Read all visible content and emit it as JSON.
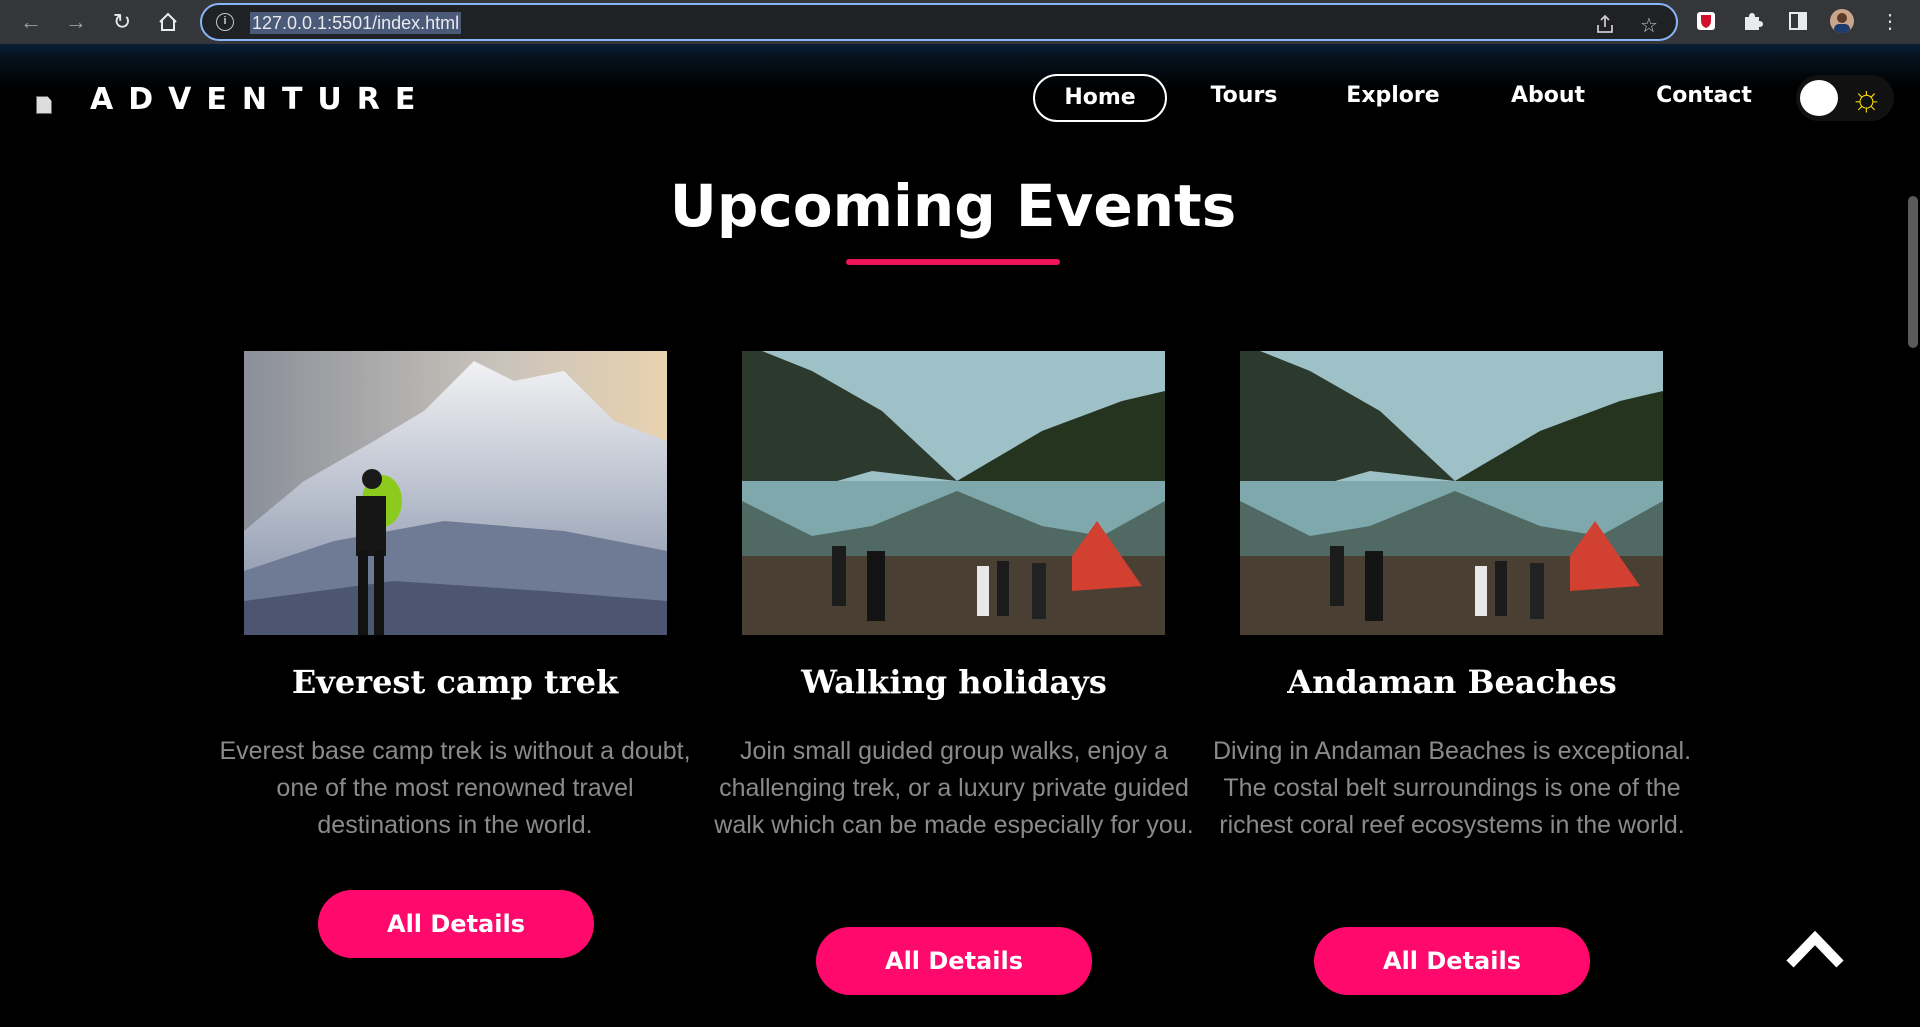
{
  "browser": {
    "url": "127.0.0.1:5501/index.html",
    "back_icon": "arrow-left-icon",
    "forward_icon": "arrow-right-icon",
    "reload_icon": "reload-icon",
    "home_icon": "home-icon"
  },
  "header": {
    "logo_text": "ADVENTURE",
    "nav": [
      {
        "label": "Home",
        "active": true
      },
      {
        "label": "Tours",
        "active": false
      },
      {
        "label": "Explore",
        "active": false
      },
      {
        "label": "About",
        "active": false
      },
      {
        "label": "Contact",
        "active": false
      }
    ],
    "theme_toggle_icon": "sun-icon"
  },
  "section": {
    "title": "Upcoming Events",
    "accent_color": "#f0145a"
  },
  "cards": [
    {
      "title": "Everest camp trek",
      "description": "Everest base camp trek is without a doubt, one of the most renowned travel destinations in the world.",
      "button": "All Details",
      "image": "mountain-hiker-image"
    },
    {
      "title": "Walking holidays",
      "description": "Join small guided group walks, enjoy a challenging trek, or a luxury private guided walk which can be made especially for you.",
      "button": "All Details",
      "image": "lake-camp-image"
    },
    {
      "title": "Andaman Beaches",
      "description": "Diving in Andaman Beaches is exceptional. The costal belt surroundings is one of the richest coral reef ecosystems in the world.",
      "button": "All Details",
      "image": "lake-camp-image"
    }
  ],
  "colors": {
    "button": "#ff0a6c",
    "background": "#000000",
    "text_muted": "#8a8a8a"
  }
}
